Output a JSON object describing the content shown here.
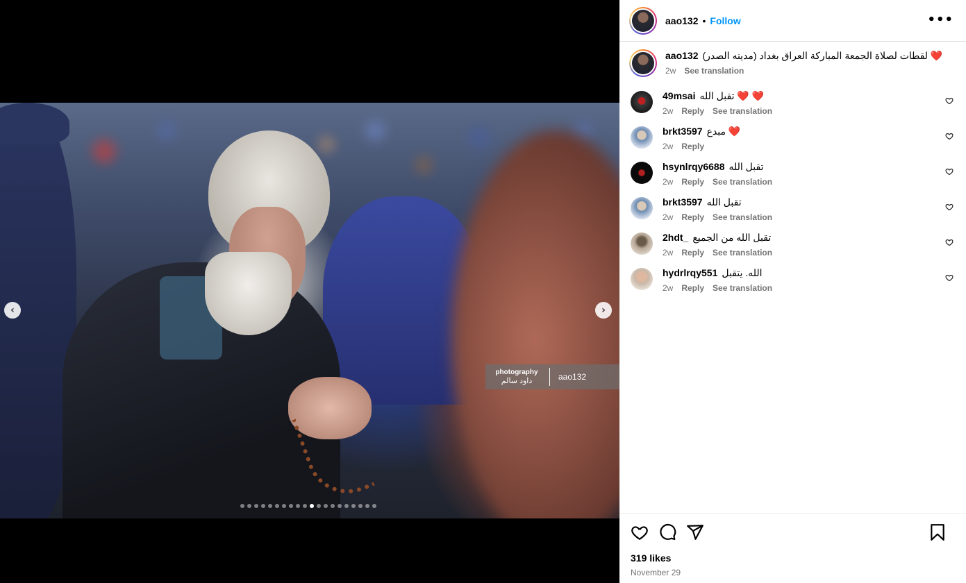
{
  "post": {
    "username": "aao132",
    "separator": "•",
    "follow_label": "Follow",
    "more_label": "•••"
  },
  "media": {
    "watermark_photography": "photography",
    "watermark_arabic": "داود سالم",
    "watermark_handle": "aao132",
    "prev_label": "‹",
    "next_label": "›",
    "carousel_total": 20,
    "carousel_active_index": 10
  },
  "caption": {
    "username": "aao132",
    "text": "❤️ لقطات لصلاة الجمعة المباركة العراق بغداد (مدينه الصدر)",
    "time": "2w",
    "see_translation": "See translation"
  },
  "comments": [
    {
      "username": "49msai",
      "text": "❤️ ❤️ تقبل الله",
      "time": "2w",
      "reply": "Reply",
      "see_translation": "See translation"
    },
    {
      "username": "brkt3597",
      "text": "❤️ مبدع",
      "time": "2w",
      "reply": "Reply",
      "see_translation": ""
    },
    {
      "username": "hsynlrqy6688",
      "text": "تقبل الله",
      "time": "2w",
      "reply": "Reply",
      "see_translation": "See translation"
    },
    {
      "username": "brkt3597",
      "text": "تقبل الله",
      "time": "2w",
      "reply": "Reply",
      "see_translation": "See translation"
    },
    {
      "username": "2hdt_",
      "text": "تقبل الله من الجميع",
      "time": "2w",
      "reply": "Reply",
      "see_translation": "See translation"
    },
    {
      "username": "hydrlrqy551",
      "text": "الله. يتقبل",
      "time": "2w",
      "reply": "Reply",
      "see_translation": "See translation"
    }
  ],
  "footer": {
    "likes": "319 likes",
    "date": "November 29"
  },
  "icons": {
    "heart": "heart-icon",
    "comment": "comment-icon",
    "share": "share-icon",
    "bookmark": "bookmark-icon",
    "more": "more-icon"
  },
  "colors": {
    "accent": "#0095f6",
    "heart_red": "#ff3040",
    "meta_gray": "#737373"
  }
}
